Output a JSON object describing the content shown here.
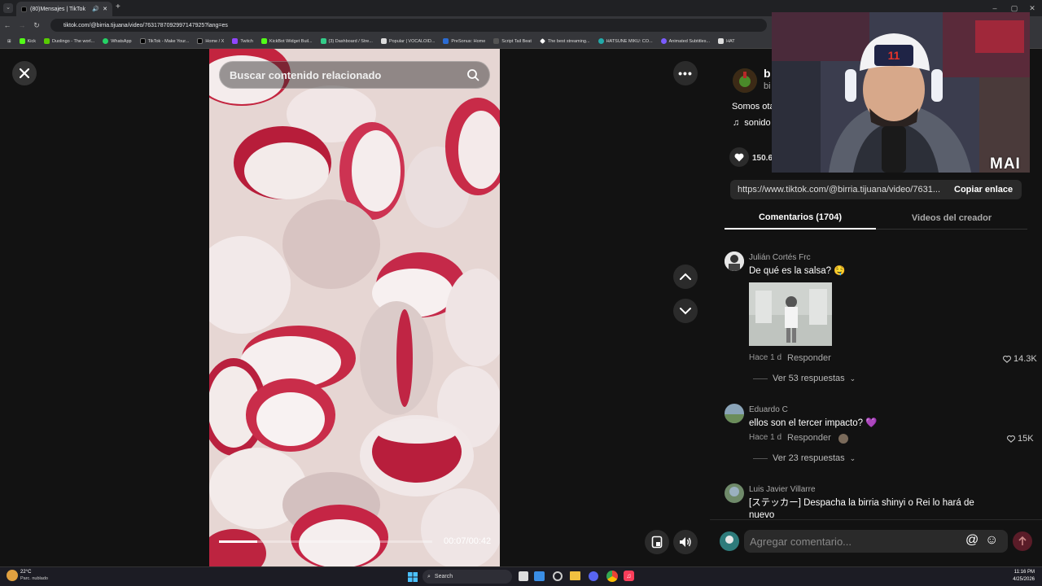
{
  "browser": {
    "tab_title": "(80)Mensajes | TikTok",
    "url": "tiktok.com/@birria.tijuana/video/7631787092997147925?lang=es",
    "bookmarks": [
      "Kick",
      "Duolingo - The worl...",
      "WhatsApp",
      "TikTok - Make Your...",
      "Home / X",
      "Twitch",
      "KickBot Widget Buil...",
      "(3) Dashboard / Stre...",
      "Popular | VOCALOID...",
      "PreSonus: Home",
      "Script Tail Beat",
      "The best streaming...",
      "HATSUNE MIKU: CO...",
      "Animated Subtitles...",
      "HAT"
    ]
  },
  "video": {
    "search_placeholder": "Buscar contenido relacionado",
    "time": "00:07/00:42",
    "progress": 0.18
  },
  "post": {
    "author_initial": "b",
    "author_sub": "bi",
    "description": "Somos ota",
    "sound": "sonido",
    "likes": "150.6",
    "link": "https://www.tiktok.com/@birria.tijuana/video/7631...",
    "copy_label": "Copiar enlace"
  },
  "tabs": {
    "comments": "Comentarios (1704)",
    "creator_videos": "Videos del creador"
  },
  "comments": [
    {
      "name": "Julián Cortés Frc",
      "text": "De qué es la salsa? 🤤",
      "time": "Hace 1 d",
      "reply": "Responder",
      "likes": "14.3K",
      "replies": "Ver 53 respuestas"
    },
    {
      "name": "Eduardo C",
      "text": "ellos son el tercer impacto? 💜",
      "time": "Hace 1 d",
      "reply": "Responder",
      "likes": "15K",
      "replies": "Ver 23 respuestas"
    },
    {
      "name": "Luis Javier Villarre",
      "text": "[ステッカー] Despacha la birria shinyi o Rei lo hará de nuevo"
    }
  ],
  "comment_input": {
    "placeholder": "Agregar comentario..."
  },
  "webcam": {
    "overlay": "MAI"
  },
  "taskbar": {
    "weather_temp": "22°C",
    "weather_desc": "Parc. nublado",
    "search": "Search",
    "time": "11:16 PM",
    "date": "4/25/2026"
  },
  "colors": {
    "accent": "#fe2c55",
    "background": "#121212"
  }
}
